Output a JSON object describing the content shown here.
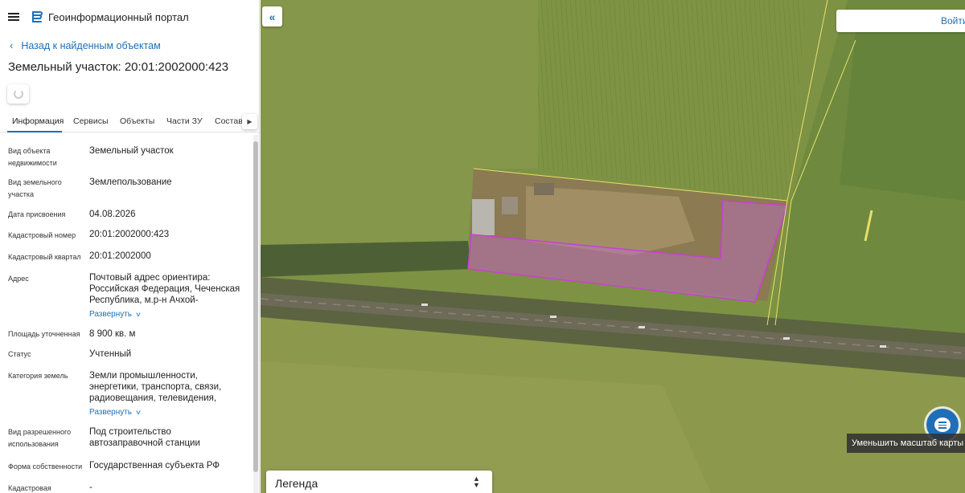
{
  "header": {
    "portal_title": "Геоинформационный портал"
  },
  "nav": {
    "back_label": "Назад к найденным объектам"
  },
  "page_title": "Земельный участок: 20:01:2002000:423",
  "tabs": [
    {
      "label": "Информация",
      "active": true
    },
    {
      "label": "Сервисы"
    },
    {
      "label": "Объекты"
    },
    {
      "label": "Части ЗУ"
    },
    {
      "label": "Состав"
    }
  ],
  "details": {
    "object_type": {
      "label": "Вид объекта недвижимости",
      "value": "Земельный участок"
    },
    "parcel_type": {
      "label": "Вид земельного участка",
      "value": "Землепользование"
    },
    "assigned_date": {
      "label": "Дата присвоения",
      "value": "04.08.2026"
    },
    "cadastral_number": {
      "label": "Кадастровый номер",
      "value": "20:01:2002000:423"
    },
    "cadastral_quarter": {
      "label": "Кадастровый квартал",
      "value": "20:01:2002000"
    },
    "address": {
      "label": "Адрес",
      "value": "Почтовый адрес ориентира: Российская Федерация, Чеченская Республика, м.р-н Ачхой-"
    },
    "area": {
      "label": "Площадь уточненная",
      "value": "8 900 кв. м"
    },
    "status": {
      "label": "Статус",
      "value": "Учтенный"
    },
    "land_category": {
      "label": "Категория земель",
      "value": "Земли промышленности, энергетики, транспорта, связи, радиовещания, телевидения,"
    },
    "permitted_use": {
      "label": "Вид разрешенного использования",
      "value": "Под строительство автозаправочной станции"
    },
    "ownership": {
      "label": "Форма собственности",
      "value": "Государственная субъекта РФ"
    },
    "cadastral_cost": {
      "label": "Кадастровая",
      "value": "-"
    }
  },
  "expand_label": "Развернуть",
  "map": {
    "login_label": "Войти",
    "legend_label": "Легенда",
    "tooltip": "Уменьшить масштаб карты"
  },
  "colors": {
    "accent": "#1f6fb8",
    "parcel_fill": "#c06bc9",
    "parcel_outline": "#c93fd6",
    "boundary_yellow": "#e8e06a"
  }
}
